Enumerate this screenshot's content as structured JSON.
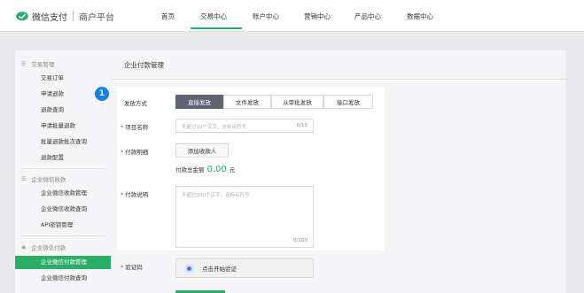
{
  "header": {
    "logo_text": "微信支付",
    "platform": "商户平台",
    "nav": [
      "首页",
      "交易中心",
      "账户中心",
      "营销中心",
      "产品中心",
      "数据中心"
    ],
    "active_nav_index": 1
  },
  "sidebar": {
    "groups": [
      {
        "title": "交易管理",
        "items": [
          "交易订单",
          "申请退款",
          "退款查询",
          "申请批量退款",
          "批量退款批次查询",
          "退款配置"
        ]
      },
      {
        "title": "企业微信收款",
        "items": [
          "企业微信收款管理",
          "企业微信收款查询",
          "API密钥管理"
        ]
      },
      {
        "title": "企业微信付款",
        "items": [
          "企业微信付款管理",
          "企业微信付款查询"
        ]
      }
    ],
    "active_item": "企业微信付款管理"
  },
  "content": {
    "title": "企业付款管理",
    "step_badge": "1",
    "pay_method": {
      "label": "发放方式",
      "options": [
        "直接发放",
        "文件发放",
        "从审批发放",
        "接口发放"
      ],
      "selected_index": 0
    },
    "project_name": {
      "label": "项目名称",
      "placeholder": "不超过10个汉字，含标点符号",
      "counter": "0/10"
    },
    "payment_detail": {
      "label": "付款明细",
      "add_button": "添加收款人",
      "balance_label": "付款总金额",
      "balance_value": "0.00",
      "balance_unit": "元"
    },
    "payment_note": {
      "label": "付款说明",
      "placeholder": "不超过100个汉字，含标点符号",
      "counter": "0/100"
    },
    "captcha": {
      "label": "验证码",
      "button": "点击开始验证"
    }
  },
  "colors": {
    "brand_green": "#2aae67",
    "segment_active": "#5e6472",
    "badge_blue": "#1581e8",
    "required_red": "#e64340"
  }
}
